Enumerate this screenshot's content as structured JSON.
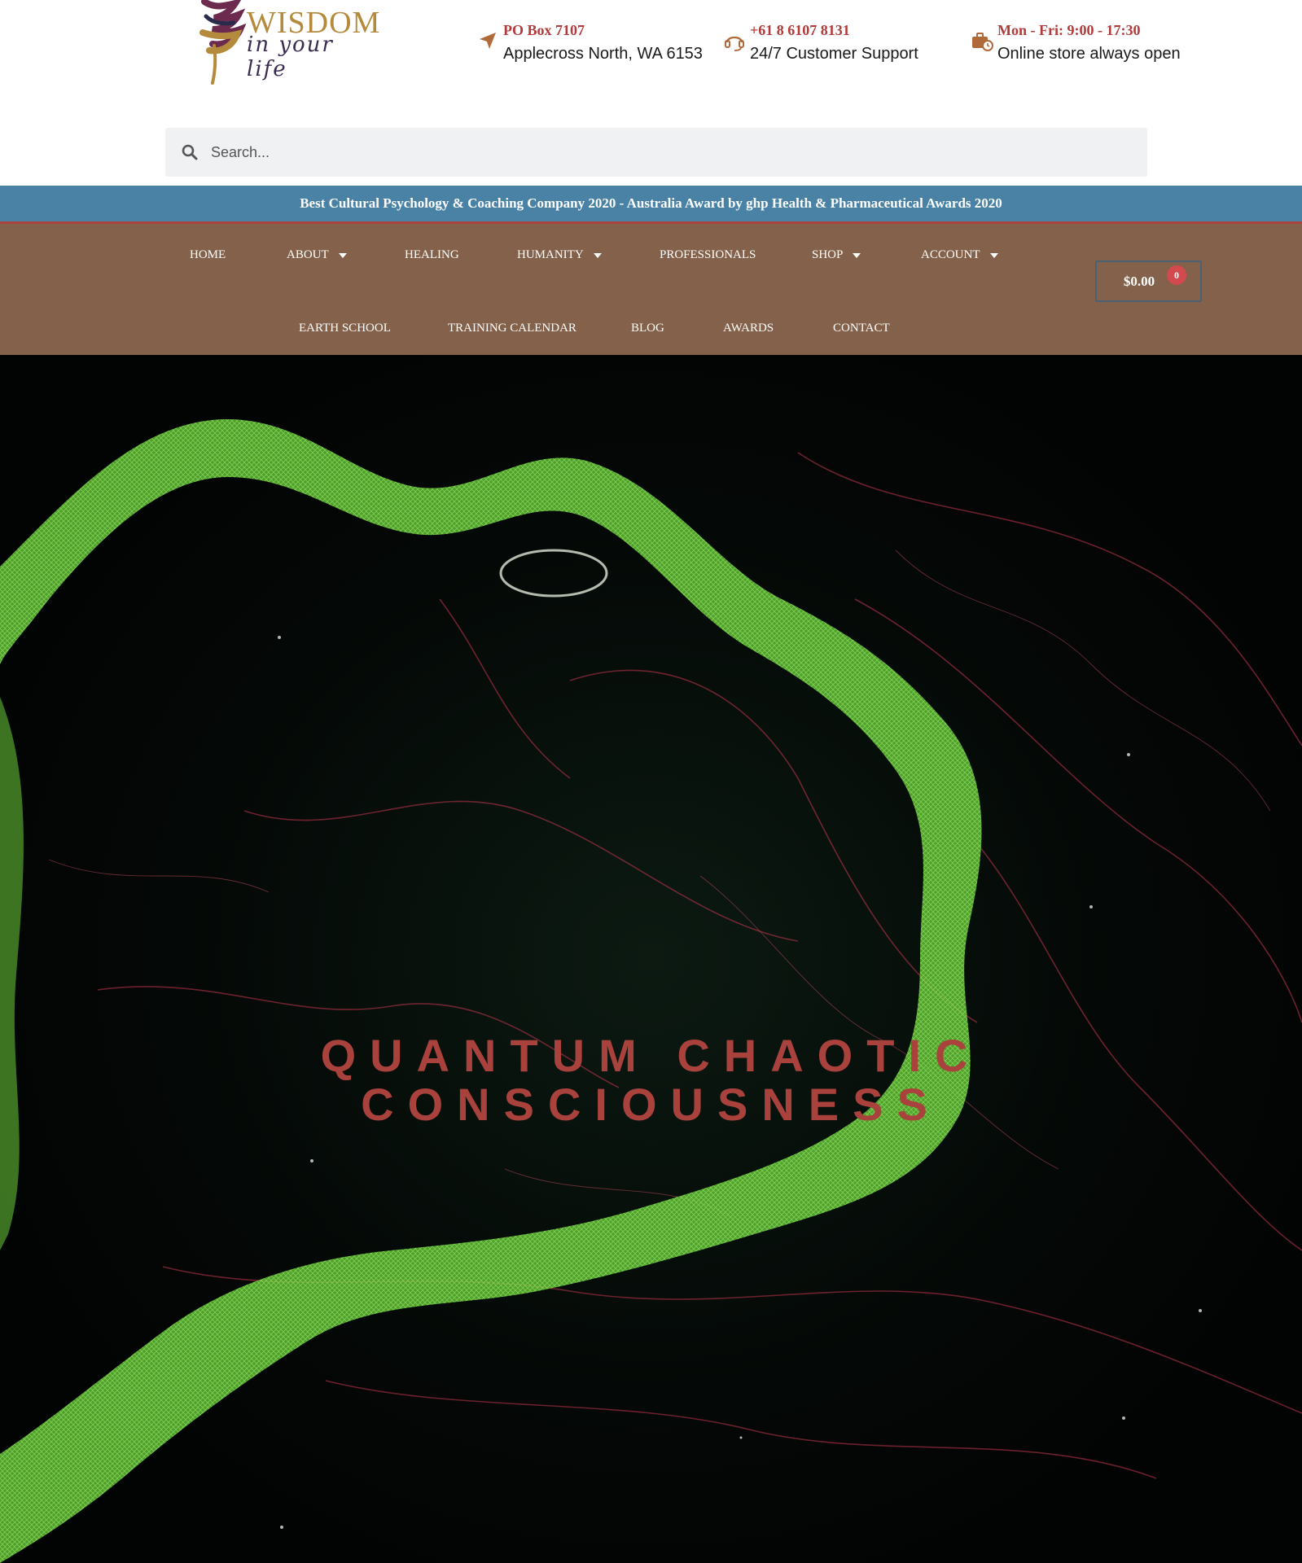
{
  "logo": {
    "word": "WISDOM",
    "script": "in your life",
    "icon": "feather-logo-icon"
  },
  "contacts": [
    {
      "title": "PO Box 7107",
      "text": "Applecross North, WA 6153",
      "icon": "location-arrow-icon"
    },
    {
      "title": "+61 8 6107 8131",
      "text": "24/7 Customer Support",
      "icon": "headset-icon"
    },
    {
      "title": "Mon - Fri: 9:00 - 17:30",
      "text": "Online store always open",
      "icon": "briefcase-clock-icon"
    }
  ],
  "search": {
    "placeholder": "Search...",
    "icon": "search-icon"
  },
  "banner": {
    "text": "Best Cultural Psychology & Coaching Company 2020 - Australia Award by ghp Health & Pharmaceutical Awards 2020"
  },
  "nav": {
    "row1": [
      {
        "label": "HOME"
      },
      {
        "label": "ABOUT",
        "dropdown": true
      },
      {
        "label": "HEALING"
      },
      {
        "label": "HUMANITY",
        "dropdown": true
      },
      {
        "label": "PROFESSIONALS"
      },
      {
        "label": "SHOP",
        "dropdown": true
      },
      {
        "label": "ACCOUNT",
        "dropdown": true
      }
    ],
    "row2": [
      {
        "label": "EARTH SCHOOL"
      },
      {
        "label": "TRAINING CALENDAR"
      },
      {
        "label": "BLOG"
      },
      {
        "label": "AWARDS"
      },
      {
        "label": "CONTACT"
      }
    ]
  },
  "cart": {
    "amount": "$0.00",
    "count": "0"
  },
  "hero": {
    "title_line1": "QUANTUM CHAOTIC",
    "title_line2": "CONSCIOUSNESS"
  },
  "colors": {
    "accent_red": "#b23a3a",
    "banner_blue": "#4a82a5",
    "nav_brown": "#84614a",
    "logo_gold": "#b48a3c",
    "logo_purple": "#3b2b52",
    "hero_title": "#a9423c",
    "hero_green": "#7be04c",
    "hero_red": "#c2374f"
  }
}
